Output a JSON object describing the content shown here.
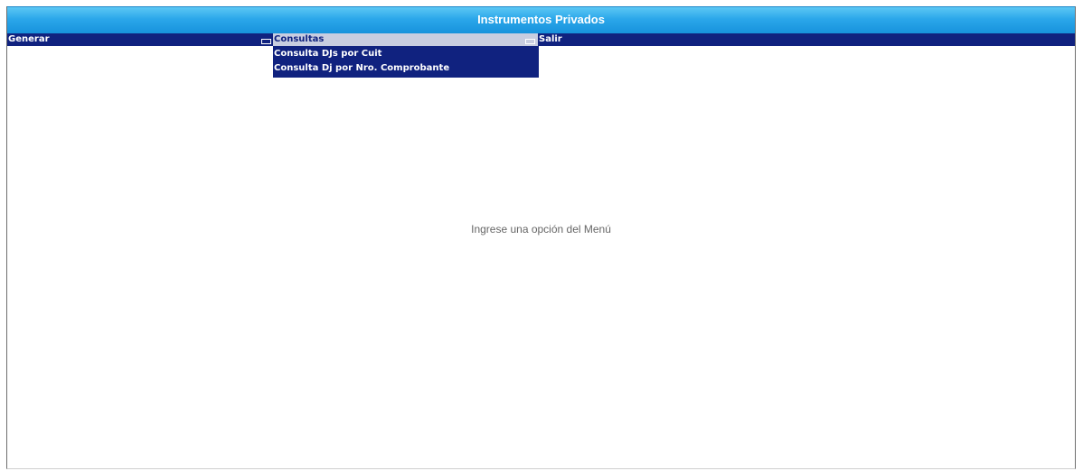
{
  "header": {
    "title": "Instrumentos Privados"
  },
  "menu": {
    "items": [
      {
        "label": "Generar"
      },
      {
        "label": "Consultas"
      },
      {
        "label": "Salir"
      }
    ],
    "consultas_submenu": [
      {
        "label": "Consulta DJs por Cuit"
      },
      {
        "label": "Consulta Dj por Nro. Comprobante"
      }
    ]
  },
  "main": {
    "message": "Ingrese una opción del Menú"
  },
  "colors": {
    "title_gradient_top": "#5cc7f4",
    "title_gradient_bottom": "#1792dc",
    "menu_bg": "#10227f",
    "menu_active_bg": "#c8cde0",
    "message_text": "#666666"
  },
  "icons": {
    "menu_collapse": "collapse-icon"
  }
}
